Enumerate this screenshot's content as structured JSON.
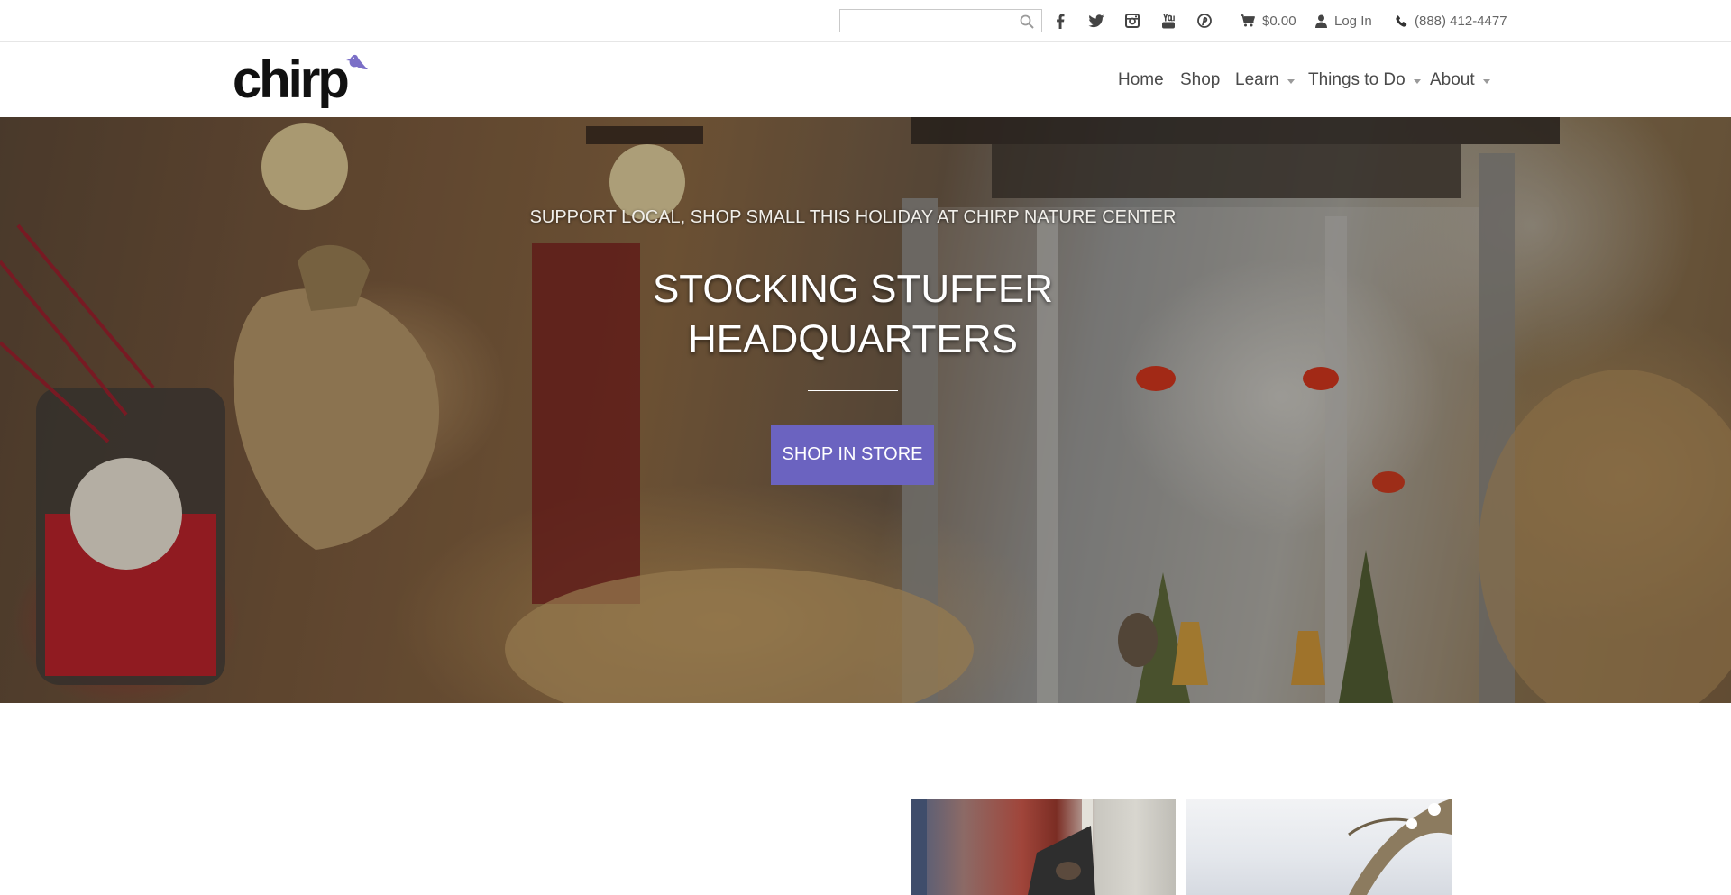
{
  "topbar": {
    "search": {
      "value": "",
      "placeholder": ""
    },
    "social_icons": [
      "facebook-icon",
      "twitter-icon",
      "instagram-icon",
      "youtube-icon",
      "pinterest-icon"
    ],
    "cart": {
      "icon": "cart-icon",
      "total": "$0.00"
    },
    "login": {
      "icon": "user-icon",
      "label": "Log In"
    },
    "phone": {
      "icon": "phone-icon",
      "number": "(888) 412-4477"
    }
  },
  "header": {
    "logo_text": "chirp",
    "nav": [
      {
        "label": "Home",
        "dropdown": false
      },
      {
        "label": "Shop",
        "dropdown": false
      },
      {
        "label": "Learn",
        "dropdown": true
      },
      {
        "label": "Things to Do",
        "dropdown": true
      },
      {
        "label": "About",
        "dropdown": true
      }
    ]
  },
  "hero": {
    "subtitle": "SUPPORT LOCAL, SHOP SMALL THIS HOLIDAY AT CHIRP NATURE CENTER",
    "title": "STOCKING STUFFER HEADQUARTERS",
    "button_label": "SHOP IN STORE"
  },
  "colors": {
    "accent": "#6b63c0",
    "logo_bird": "#7b6fc7",
    "text_dark": "#4a4a4a",
    "util_text": "#666666"
  }
}
